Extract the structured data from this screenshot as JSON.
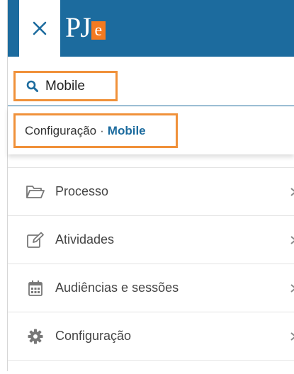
{
  "header": {
    "close_icon": "close-icon",
    "logo_text": "PJe",
    "accent_color": "#1c6b9e",
    "logo_accent": "#f47a20"
  },
  "search": {
    "value": "Mobile",
    "icon": "search-icon",
    "highlight_color": "#f0913a"
  },
  "suggestion": {
    "section": "Configuração",
    "separator": "·",
    "match": "Mobile"
  },
  "menu": {
    "items": [
      {
        "label": "Processo",
        "icon": "folder-open-icon"
      },
      {
        "label": "Atividades",
        "icon": "edit-icon"
      },
      {
        "label": "Audiências e sessões",
        "icon": "calendar-icon"
      },
      {
        "label": "Configuração",
        "icon": "gear-icon"
      }
    ]
  }
}
